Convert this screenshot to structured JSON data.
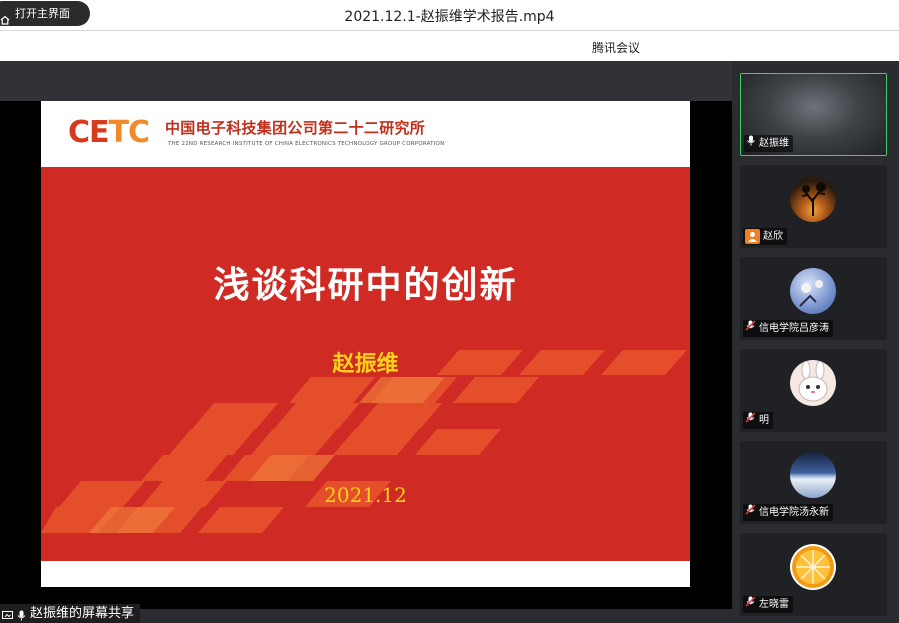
{
  "window": {
    "title": "2021.12.1-赵振维学术报告.mp4",
    "home_button": "打开主界面"
  },
  "app": {
    "title": "腾讯会议"
  },
  "slide": {
    "logo": {
      "text_main": "CE",
      "text_accent": "TC"
    },
    "org_cn": "中国电子科技集团公司第二十二研究所",
    "org_en": "THE 22ND RESEARCH INSTITUTE OF CHINA ELECTRONICS TECHNOLOGY GROUP CORPORATION",
    "title": "浅谈科研中的创新",
    "author": "赵振维",
    "date": "2021.12",
    "colors": {
      "background": "#cf2a24",
      "text": "#ffffff",
      "accent": "#ffd21a"
    }
  },
  "share_status": "赵振维的屏幕共享",
  "participants": [
    {
      "name": "赵振维",
      "status_icon": "mic-icon",
      "avatar": "dark-video",
      "active": true
    },
    {
      "name": "赵欣",
      "status_icon": "person-icon",
      "avatar": "tree-sunset"
    },
    {
      "name": "信电学院吕彦涛",
      "status_icon": "mic-muted-icon",
      "avatar": "flowers-figure"
    },
    {
      "name": "明",
      "status_icon": "mic-muted-icon",
      "avatar": "rabbit"
    },
    {
      "name": "信电学院汤永新",
      "status_icon": "mic-muted-icon",
      "avatar": "earth-horizon"
    },
    {
      "name": "左晓雷",
      "status_icon": "mic-muted-icon",
      "avatar": "orange-slice"
    }
  ],
  "colors": {
    "active_border": "#3bd06a",
    "panel_bg": "#2a2c30"
  }
}
